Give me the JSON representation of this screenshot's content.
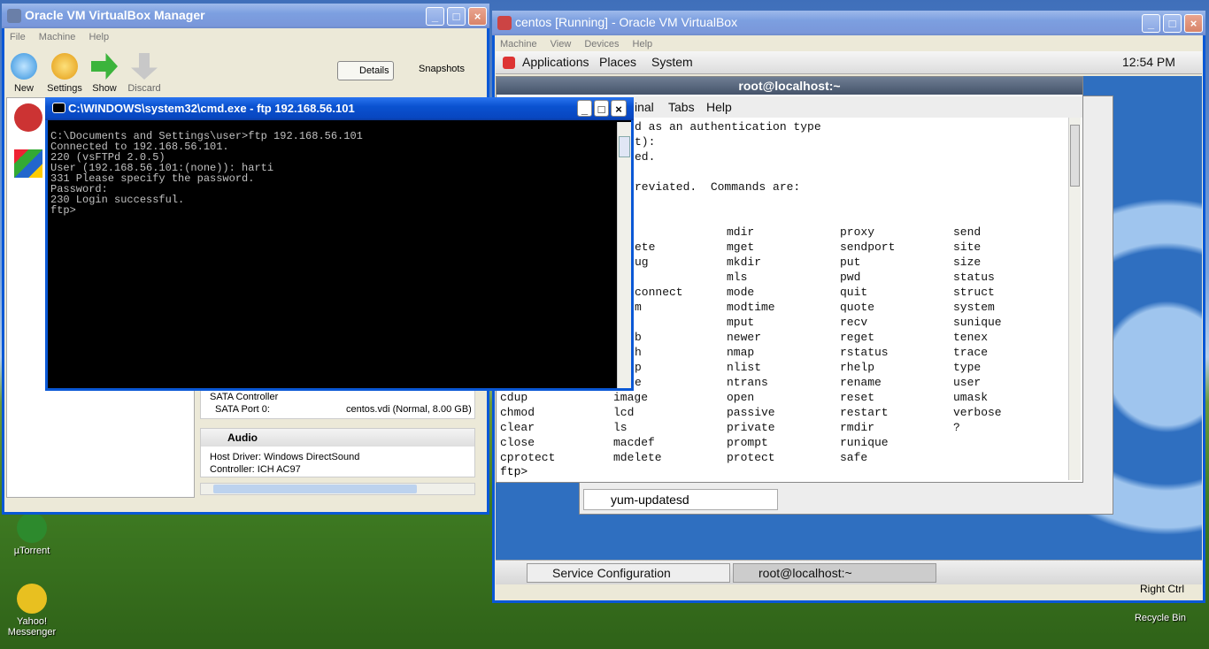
{
  "desktop": {
    "icons": [
      {
        "label": "µTorrent"
      },
      {
        "label": "Yahoo! Messenger"
      },
      {
        "label": "Recycle Bin"
      }
    ]
  },
  "vbox_manager": {
    "title": "Oracle VM VirtualBox Manager",
    "menu": [
      "File",
      "Machine",
      "Help"
    ],
    "tools": [
      "New",
      "Settings",
      "Show",
      "Discard"
    ],
    "tabs": {
      "details": "Details",
      "snapshots": "Snapshots"
    },
    "storage": {
      "controller": "SATA Controller",
      "port_label": "SATA Port 0:",
      "port_value": "centos.vdi (Normal, 8.00 GB)"
    },
    "audio": {
      "header": "Audio",
      "driver": "Host Driver:  Windows DirectSound",
      "controller": "Controller:    ICH AC97"
    }
  },
  "cmd_window": {
    "title": "C:\\WINDOWS\\system32\\cmd.exe - ftp 192.168.56.101",
    "lines": "C:\\Documents and Settings\\user>ftp 192.168.56.101\nConnected to 192.168.56.101.\n220 (vsFTPd 2.0.5)\nUser (192.168.56.101:(none)): harti\n331 Please specify the password.\nPassword:\n230 Login successful.\nftp>"
  },
  "vm_window": {
    "title": "centos [Running] - Oracle VM VirtualBox",
    "menu": [
      "Machine",
      "View",
      "Devices",
      "Help"
    ],
    "panel": {
      "applications": "Applications",
      "places": "Places",
      "system": "System",
      "clock": "12:54 PM"
    },
    "taskbar": {
      "service_config": "Service Configuration",
      "terminal": "root@localhost:~",
      "host_key": "Right Ctrl"
    },
    "service_item": "yum-updatesd"
  },
  "gnome_terminal": {
    "title": "root@localhost:~",
    "menu": {
      "terminal": "inal",
      "tabs": "Tabs",
      "help": "Help"
    },
    "top_lines": "d as an authentication type\nt):\ned.\n\nreviated.  Commands are:",
    "col2_partial": [
      "ete",
      "ug",
      "",
      "connect",
      "m",
      "",
      "b",
      "h",
      "p",
      "e"
    ],
    "rows": [
      [
        "",
        "",
        "mdir",
        "proxy",
        "send"
      ],
      [
        "",
        "",
        "mget",
        "sendport",
        "site"
      ],
      [
        "",
        "",
        "mkdir",
        "put",
        "size"
      ],
      [
        "",
        "",
        "mls",
        "pwd",
        "status"
      ],
      [
        "",
        "",
        "mode",
        "quit",
        "struct"
      ],
      [
        "",
        "",
        "modtime",
        "quote",
        "system"
      ],
      [
        "",
        "",
        "mput",
        "recv",
        "sunique"
      ],
      [
        "",
        "",
        "newer",
        "reget",
        "tenex"
      ],
      [
        "",
        "",
        "nmap",
        "rstatus",
        "trace"
      ],
      [
        "",
        "",
        "nlist",
        "rhelp",
        "type"
      ],
      [
        "",
        "",
        "ntrans",
        "rename",
        "user"
      ],
      [
        "cdup",
        "image",
        "open",
        "reset",
        "umask"
      ],
      [
        "chmod",
        "lcd",
        "passive",
        "restart",
        "verbose"
      ],
      [
        "clear",
        "ls",
        "private",
        "rmdir",
        "?"
      ],
      [
        "close",
        "macdef",
        "prompt",
        "runique",
        ""
      ],
      [
        "cprotect",
        "mdelete",
        "protect",
        "safe",
        ""
      ]
    ],
    "prompt": "ftp>"
  }
}
